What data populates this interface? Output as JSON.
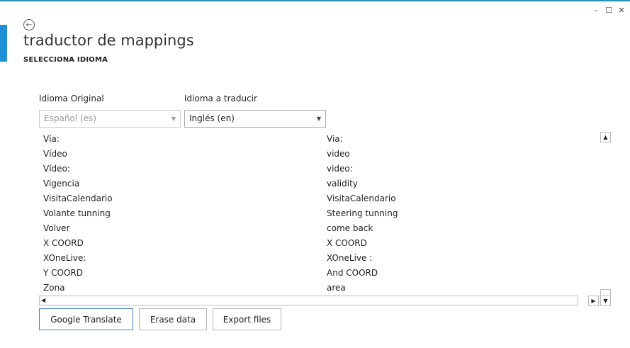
{
  "window": {
    "minimize_icon": "minimize-icon",
    "maximize_icon": "maximize-icon",
    "close_icon": "close-icon",
    "minimize": "–",
    "maximize": "☐",
    "close": "✕"
  },
  "header": {
    "back_icon": "back-arrow-icon",
    "back_glyph": "←",
    "title": "traductor de mappings",
    "subtitle": "SELECCIONA IDIOMA"
  },
  "languages": {
    "original_label": "Idioma Original",
    "original_value": "Español (es)",
    "target_label": "Idioma a traducir",
    "target_value": "Inglés (en)",
    "dropdown_glyph": "▼"
  },
  "rows": [
    {
      "source": "Vía:",
      "target": "Via:"
    },
    {
      "source": "Vídeo",
      "target": "video"
    },
    {
      "source": "Vídeo:",
      "target": "video:"
    },
    {
      "source": "Vigencia",
      "target": "validity"
    },
    {
      "source": "VisitaCalendario",
      "target": "VisitaCalendario"
    },
    {
      "source": "Volante tunning",
      "target": "Steering tunning"
    },
    {
      "source": "Volver",
      "target": "come back"
    },
    {
      "source": "X COORD",
      "target": "X COORD"
    },
    {
      "source": "XOneLive:",
      "target": "XOneLive :"
    },
    {
      "source": "Y COORD",
      "target": "And COORD"
    },
    {
      "source": "Zona",
      "target": "area"
    }
  ],
  "scroll": {
    "up": "▲",
    "down": "▼",
    "left": "◀",
    "right": "▶"
  },
  "buttons": {
    "google_translate": "Google Translate",
    "erase_data": "Erase data",
    "export_files": "Export files"
  },
  "colors": {
    "accent": "#1f8fd6",
    "topline": "#2a8fbd",
    "primary_button_border": "#3f80c4"
  }
}
